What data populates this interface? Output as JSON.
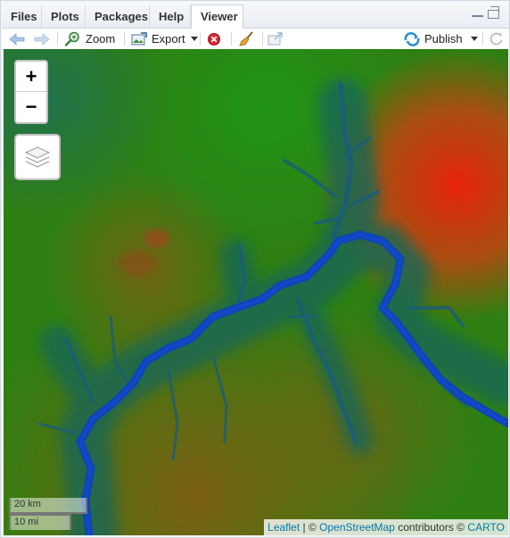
{
  "tabs": [
    {
      "label": "Files",
      "active": false
    },
    {
      "label": "Plots",
      "active": false
    },
    {
      "label": "Packages",
      "active": false
    },
    {
      "label": "Help",
      "active": false
    },
    {
      "label": "Viewer",
      "active": true
    }
  ],
  "toolbar": {
    "zoom_label": "Zoom",
    "export_label": "Export",
    "publish_label": "Publish",
    "icons": [
      "back-arrow-icon",
      "forward-arrow-icon",
      "zoom-magnifier-icon",
      "export-image-icon",
      "remove-icon",
      "broom-clear-icon",
      "popout-viewer-icon",
      "publish-icon",
      "refresh-icon"
    ]
  },
  "map": {
    "zoom_in_label": "+",
    "zoom_out_label": "−",
    "scale_km": "20 km",
    "scale_mi": "10 mi",
    "attribution": {
      "leaflet": "Leaflet",
      "sep1": " | © ",
      "osm": "OpenStreetMap",
      "contrib": " contributors © ",
      "carto": "CARTO"
    },
    "colors": {
      "high": "#e8220a",
      "mid": "#2e7f12",
      "low": "#0a3fb0",
      "link": "#0078a8"
    }
  }
}
